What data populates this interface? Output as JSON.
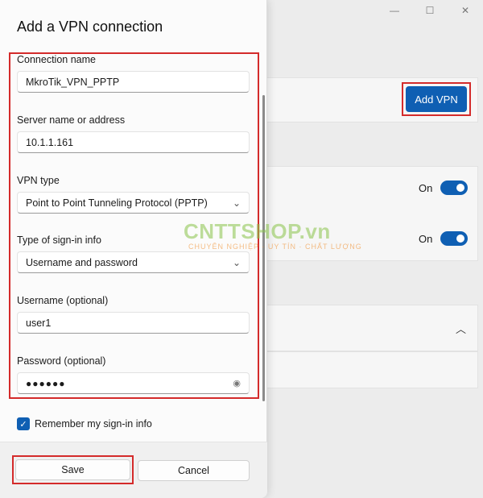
{
  "dialog": {
    "title": "Add a VPN connection",
    "fields": {
      "connection_name": {
        "label": "Connection name",
        "value": "MkroTik_VPN_PPTP"
      },
      "server": {
        "label": "Server name or address",
        "value": "10.1.1.161"
      },
      "vpn_type": {
        "label": "VPN type",
        "value": "Point to Point Tunneling Protocol (PPTP)"
      },
      "signin_type": {
        "label": "Type of sign-in info",
        "value": "Username and password"
      },
      "username": {
        "label": "Username (optional)",
        "value": "user1"
      },
      "password": {
        "label": "Password (optional)",
        "value": "●●●●●●"
      }
    },
    "remember_label": "Remember my sign-in info",
    "save_label": "Save",
    "cancel_label": "Cancel"
  },
  "background": {
    "add_vpn_label": "Add VPN",
    "toggle_1_label": "On",
    "toggle_2_label": "On"
  },
  "watermark": {
    "brand": "CNTTSHOP.vn",
    "tagline": "CHUYÊN NGHIỆP · UY TÍN · CHẤT LƯỢNG"
  },
  "colors": {
    "accent": "#0f5fb3",
    "highlight": "#d42b2b"
  }
}
